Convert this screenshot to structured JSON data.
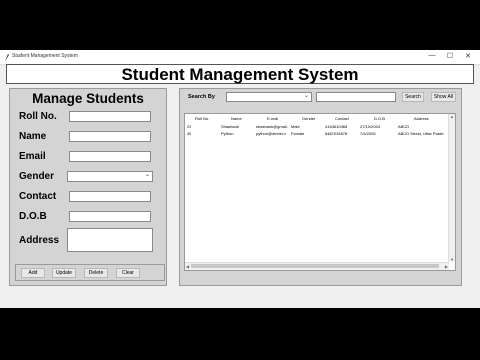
{
  "window": {
    "title": "Student Management System",
    "minimize": "—",
    "maximize": "☐",
    "close": "✕"
  },
  "header": {
    "title": "Student Management System"
  },
  "manage": {
    "title": "Manage Students",
    "labels": {
      "roll": "Roll No.",
      "name": "Name",
      "email": "Email",
      "gender": "Gender",
      "contact": "Contact",
      "dob": "D.O.B",
      "address": "Address"
    },
    "values": {
      "roll": "",
      "name": "",
      "email": "",
      "gender": "",
      "contact": "",
      "dob": "",
      "address": ""
    },
    "buttons": {
      "add": "Add",
      "update": "Update",
      "delete": "Delete",
      "clear": "Clear"
    }
  },
  "search": {
    "label": "Search By",
    "by_value": "",
    "text": "",
    "search_button": "Search",
    "show_all_button": "Show All"
  },
  "table": {
    "headers": [
      "Roll No.",
      "Name",
      "E-mail",
      "Gender",
      "Contact",
      "D.O.B",
      "Address"
    ],
    "rows": [
      [
        "23",
        "Shashank",
        "shashank@gmail.",
        "Male",
        "4154610468",
        "27/10/2004",
        "ABCD"
      ],
      [
        "45",
        "Python",
        "python@dexter.c",
        "Female",
        "8487034678",
        "7/4/2005",
        "ABCD Street, Uttar Prade"
      ]
    ]
  },
  "colors": {
    "panel": "#d4d4d4",
    "window": "#f0f0f0",
    "field": "#ffffff"
  }
}
